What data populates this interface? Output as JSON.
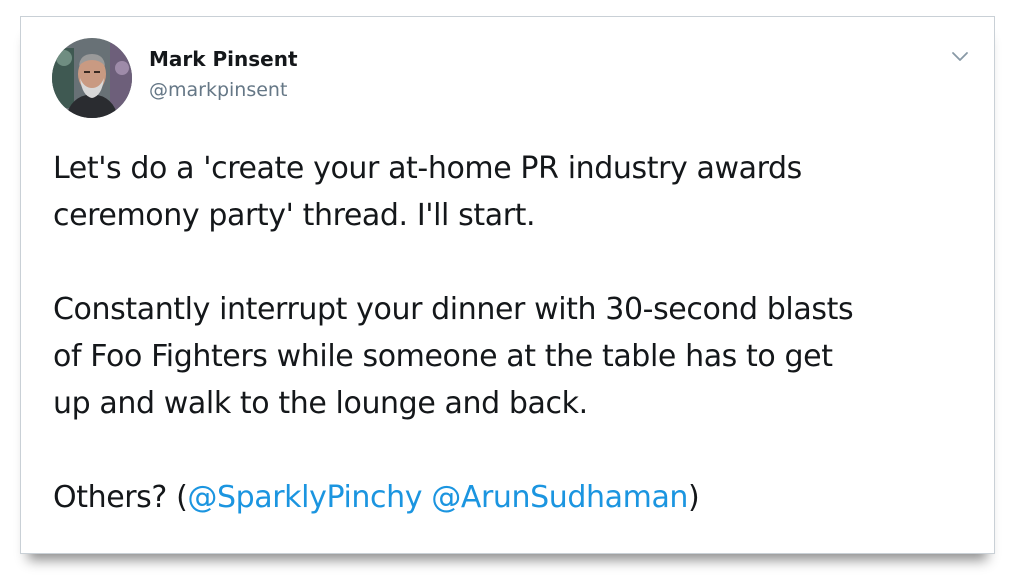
{
  "tweet": {
    "author_name": "Mark Pinsent",
    "author_handle": "@markpinsent",
    "menu_icon": "chevron-down-icon",
    "paragraph1": {
      "line1": "Let's do a 'create your at-home PR industry awards",
      "line2": "ceremony party' thread. I'll start."
    },
    "paragraph2": {
      "line1": "Constantly interrupt your dinner with 30-second blasts",
      "line2": "of Foo Fighters while someone at the table has to get",
      "line3": "up and walk to the lounge and back."
    },
    "paragraph3": {
      "prefix": "Others? (",
      "mention1": "@SparklyPinchy",
      "space": " ",
      "mention2": "@ArunSudhaman",
      "suffix": ")"
    }
  },
  "colors": {
    "text": "#14171a",
    "secondary": "#657786",
    "link": "#1b95e0",
    "border": "#c9d0d6"
  }
}
